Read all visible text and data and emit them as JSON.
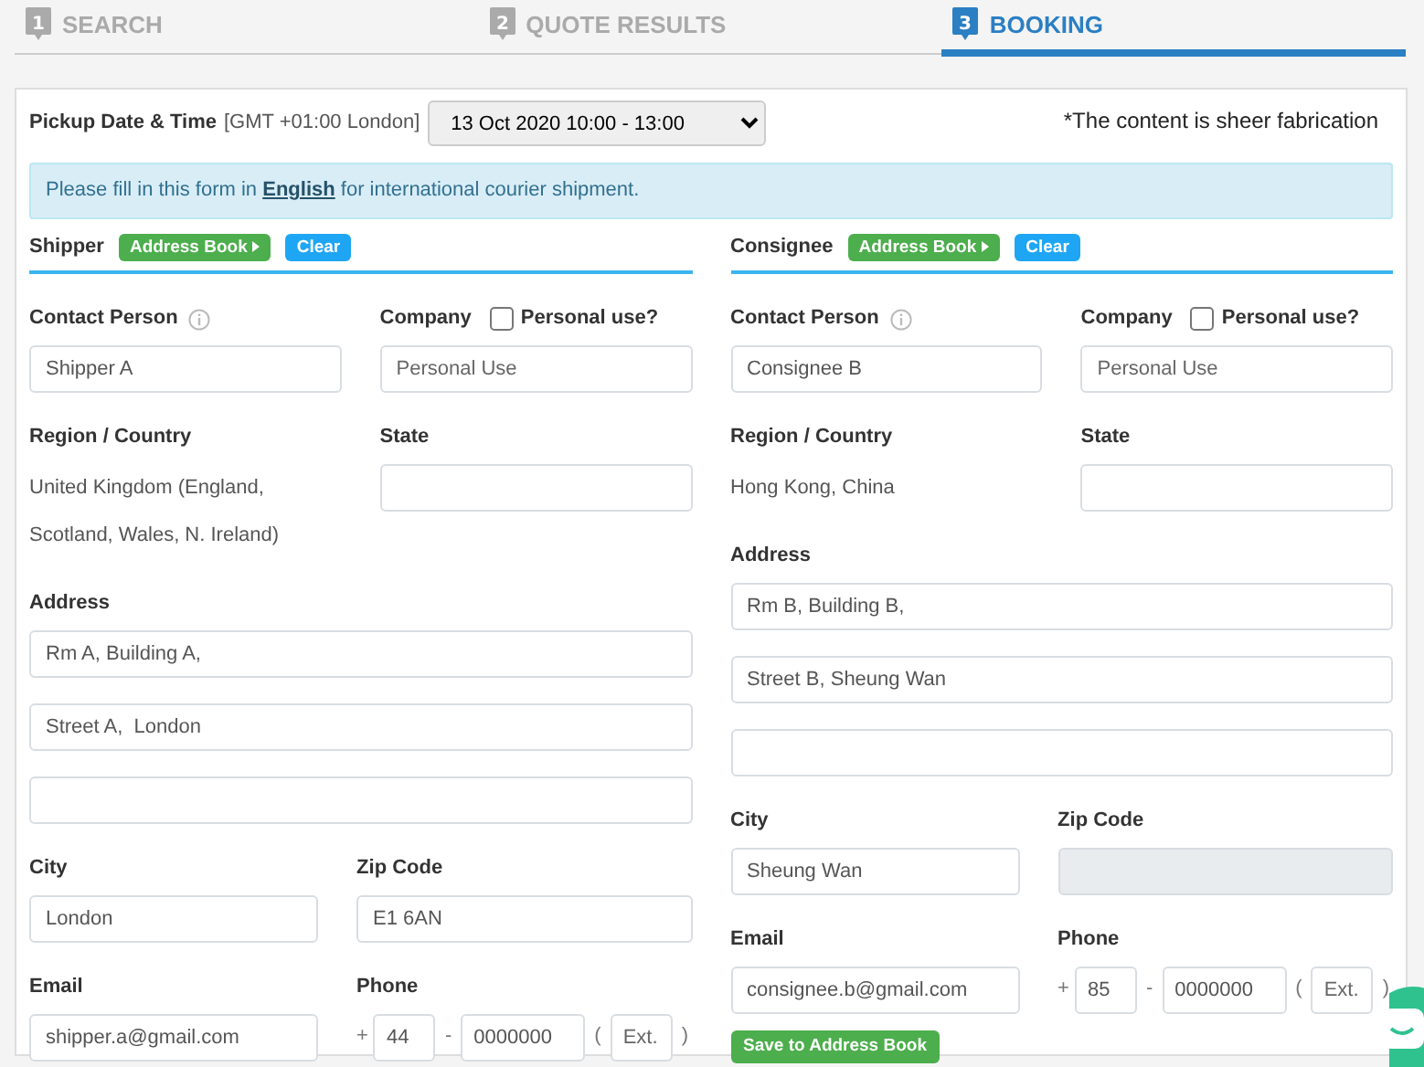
{
  "steps": [
    {
      "number": "1",
      "label": "SEARCH",
      "selected": false
    },
    {
      "number": "2",
      "label": "QUOTE RESULTS",
      "selected": false
    },
    {
      "number": "3",
      "label": "BOOKING",
      "selected": true
    }
  ],
  "pickup": {
    "label": "Pickup Date & Time",
    "timezone": "[GMT +01:00 London]",
    "value": "13 Oct 2020 10:00 - 13:00"
  },
  "note": "*The content is sheer fabrication",
  "alert": {
    "before": "Please fill in this form in ",
    "link": "English",
    "after": " for international courier shipment."
  },
  "parties": [
    {
      "title": "Shipper",
      "buttons": [
        {
          "kind": "address_book",
          "label": "Address Book"
        },
        {
          "kind": "clear",
          "label": "Clear"
        }
      ],
      "contact": {
        "label": "Contact Person",
        "value": "Shipper A"
      },
      "company": {
        "label": "Company",
        "checkbox_label": "Personal use?",
        "checked": false,
        "placeholder": "Personal Use"
      },
      "region": {
        "label": "Region / Country",
        "lines": [
          "United Kingdom (England,",
          "Scotland, Wales, N. Ireland)"
        ]
      },
      "state": {
        "label": "State"
      },
      "address": {
        "label": "Address",
        "lines": [
          "Rm A, Building A,",
          "Street A,  London"
        ]
      },
      "city": {
        "label": "City",
        "value": "London"
      },
      "zip": {
        "label": "Zip Code",
        "value": "E1 6AN",
        "disabled": false
      },
      "email": {
        "label": "Email",
        "value": "shipper.a@gmail.com"
      },
      "phone": {
        "label": "Phone",
        "plus": "+",
        "code": "44",
        "dash": "-",
        "number": "0000000",
        "open": "(",
        "ext_placeholder": "Ext.",
        "close": ")"
      }
    },
    {
      "title": "Consignee",
      "buttons": [
        {
          "kind": "address_book",
          "label": "Address Book"
        },
        {
          "kind": "clear",
          "label": "Clear"
        }
      ],
      "contact": {
        "label": "Contact Person",
        "value": "Consignee B"
      },
      "company": {
        "label": "Company",
        "checkbox_label": "Personal use?",
        "checked": false,
        "placeholder": "Personal Use"
      },
      "region": {
        "label": "Region / Country",
        "lines": [
          "Hong Kong, China"
        ]
      },
      "state": {
        "label": "State"
      },
      "address": {
        "label": "Address",
        "lines": [
          "Rm B, Building B,",
          "Street B, Sheung Wan"
        ]
      },
      "city": {
        "label": "City",
        "value": "Sheung Wan"
      },
      "zip": {
        "label": "Zip Code",
        "disabled": true
      },
      "email": {
        "label": "Email",
        "value": "consignee.b@gmail.com"
      },
      "phone": {
        "label": "Phone",
        "plus": "+",
        "code": "85",
        "dash": "-",
        "number": "0000000",
        "open": "(",
        "ext_placeholder": "Ext.",
        "close": ")"
      },
      "save_button": "Save to Address Book"
    }
  ]
}
